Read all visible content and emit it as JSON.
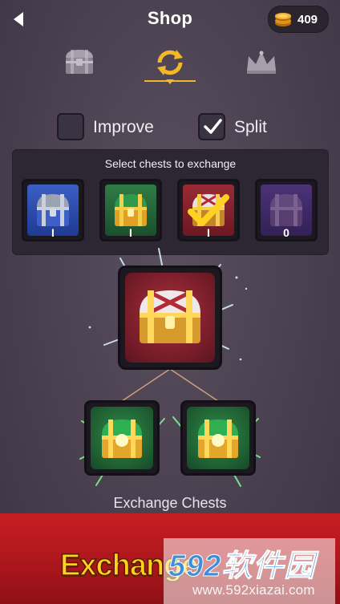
{
  "header": {
    "title": "Shop",
    "coins": "409"
  },
  "tabs": [
    {
      "icon": "chest-icon",
      "active": false
    },
    {
      "icon": "exchange-icon",
      "active": true
    },
    {
      "icon": "crown-icon",
      "active": false
    }
  ],
  "options": {
    "improve_label": "Improve",
    "improve_checked": false,
    "split_label": "Split",
    "split_checked": true
  },
  "panel": {
    "title": "Select chests to exchange",
    "slots": [
      {
        "name": "blue-chest",
        "count": "I",
        "selected": false
      },
      {
        "name": "green-chest",
        "count": "I",
        "selected": false
      },
      {
        "name": "red-chest",
        "count": "I",
        "selected": true
      },
      {
        "name": "purple-chest",
        "count": "0",
        "selected": false
      }
    ]
  },
  "exchange": {
    "label": "Exchange Chests",
    "button_label": "Exchange"
  },
  "watermark": {
    "logo": "592软件园",
    "url": "www.592xiazai.com"
  },
  "colors": {
    "banner": "#b81a1f",
    "button_text": "#ffd21f",
    "gold": "#f1b52a"
  }
}
